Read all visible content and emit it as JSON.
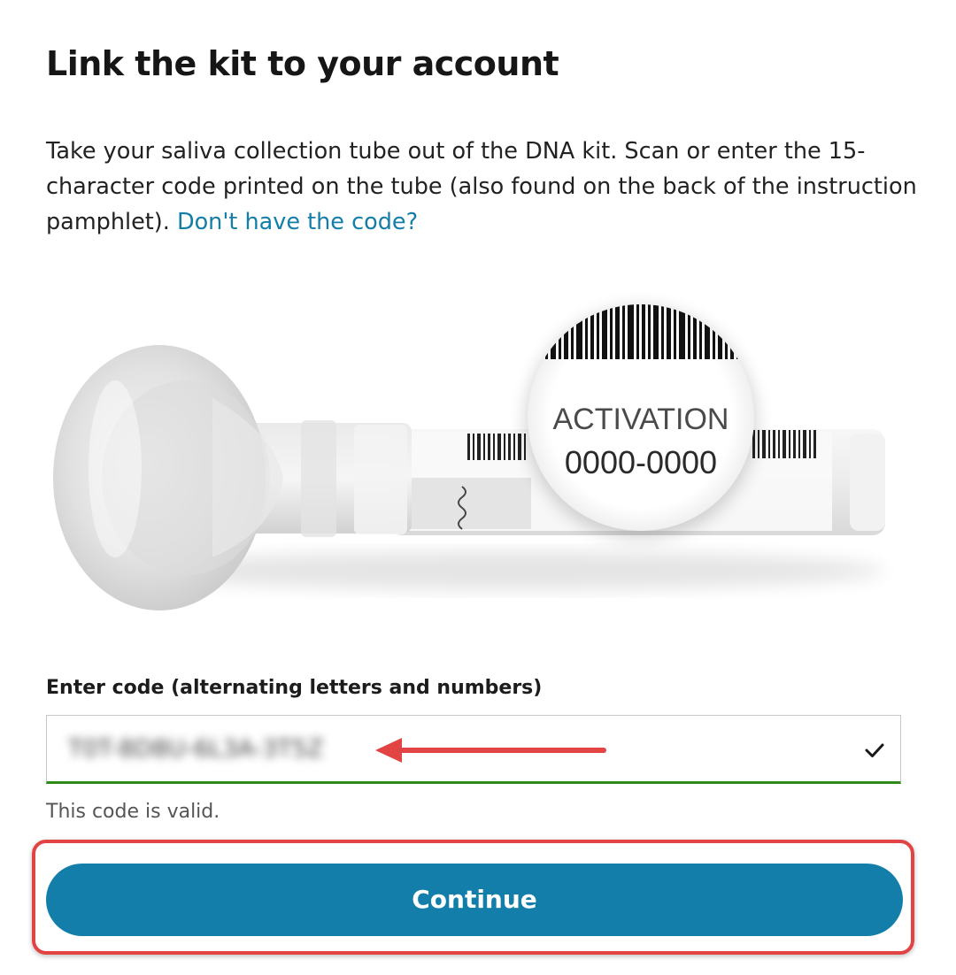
{
  "header": {
    "title": "Link the kit to your account"
  },
  "instructions": {
    "text": "Take your saliva collection tube out of the DNA kit. Scan or enter the 15-character code printed on the tube (also found on the back of the instruction pamphlet).",
    "link_text": "Don't have the code?"
  },
  "illustration": {
    "activation_label": "ACTIVATION",
    "activation_code": "0000-0000"
  },
  "code_entry": {
    "label": "Enter code (alternating letters and numbers)",
    "value": "T0T-8D8U-6L3A-3T5Z",
    "status_icon": "check-icon",
    "validation_message": "This code is valid."
  },
  "actions": {
    "continue_label": "Continue"
  },
  "colors": {
    "accent": "#127ea9",
    "link": "#137ea8",
    "valid": "#2f8a1b",
    "annotation": "#e24444"
  }
}
